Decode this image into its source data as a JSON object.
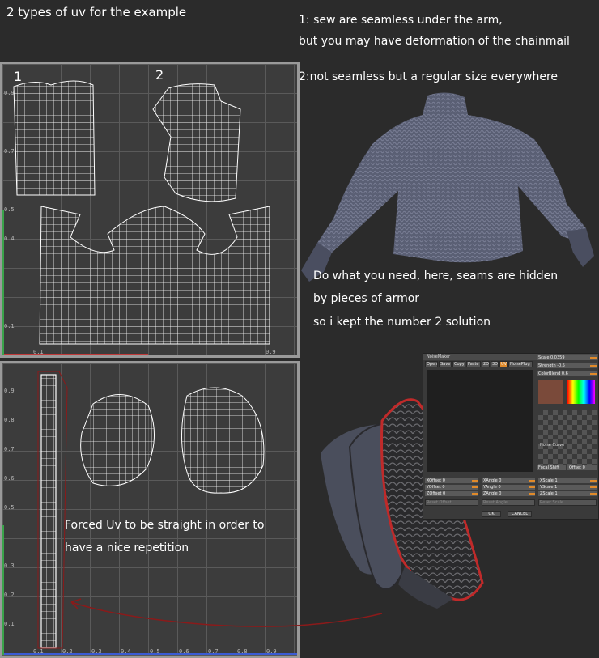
{
  "header": {
    "title": "2 types of uv for the example"
  },
  "notes": {
    "line1": "1: sew are seamless under the arm,",
    "line2": "but you may have deformation of the chainmail",
    "line3": "2:not seamless but a regular size everywhere",
    "armor1": "Do what you need, here, seams are hidden",
    "armor2": "by pieces of armor",
    "armor3": "so i kept the number 2 solution",
    "forced1": "Forced Uv to be straight in order to",
    "forced2": "have a nice repetition"
  },
  "panels": {
    "top_labels": [
      "1",
      "2"
    ],
    "y_ticks": [
      "0.9",
      "0.8",
      "0.7",
      "0.6",
      "0.5",
      "0.4",
      "0.3",
      "0.2",
      "0.1"
    ],
    "x_ticks": [
      "0.1",
      "0.2",
      "0.3",
      "0.4",
      "0.5",
      "0.6",
      "0.7",
      "0.8",
      "0.9"
    ]
  },
  "noisemaker": {
    "title": "NoiseMaker",
    "buttons": [
      "Open",
      "Save",
      "Copy",
      "Paste",
      "2D",
      "3D",
      "UV",
      "NoisePlug"
    ],
    "sliders_right": [
      "Scale 0.0359",
      "Strength -0.5",
      "ColorBlend 0.6"
    ],
    "offset_rows": [
      "XOffset 0",
      "YOffset 0",
      "ZOffset 0"
    ],
    "angle_rows": [
      "XAngle 0",
      "YAngle 0",
      "ZAngle 0"
    ],
    "scale_rows": [
      "XScale 1",
      "YScale 1",
      "ZScale 1"
    ],
    "mid_labels": [
      "Noise Curve",
      "Focal Shift",
      "Offset 0"
    ],
    "reset_labels": [
      "Reset Offset",
      "Reset Angle",
      "Reset Scale"
    ],
    "ok_label": "OK",
    "cancel_label": "CANCEL"
  },
  "colors": {
    "background": "#2b2b2b",
    "panel": "#3c3c3c",
    "wire": "#ffffff",
    "arrow": "#8b1a1a"
  }
}
